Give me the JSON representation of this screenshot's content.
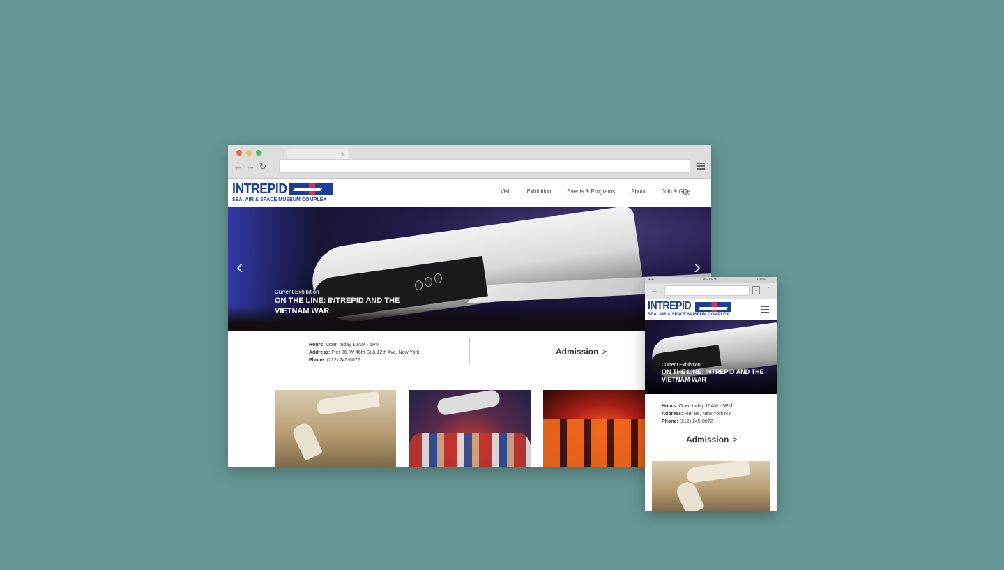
{
  "desktop": {
    "tab_close": "×",
    "nav_icons": {
      "back": "←",
      "forward": "→",
      "reload": "↻"
    },
    "logo": {
      "word": "INTREPID",
      "subtitle": "SEA, AIR & SPACE MUSEUM COMPLEX"
    },
    "nav": [
      "Visit",
      "Exhibition",
      "Events & Programs",
      "About",
      "Join & Give"
    ],
    "hero": {
      "kicker": "Current Exhibition",
      "title": "ON THE LINE: INTREPID AND THE VIETNAM WAR",
      "prev_arrow": "‹",
      "next_arrow": "›"
    },
    "info": {
      "hours_label": "Hours:",
      "hours_value": "Open today 10AM - 5PM",
      "address_label": "Address:",
      "address_value": "Pier 86, W 46th St & 12th Ave, New York",
      "phone_label": "Phone:",
      "phone_value": "(212) 245-0072"
    },
    "admission": "Admission",
    "admission_arrow": ">"
  },
  "mobile": {
    "status": {
      "left": "••••• ",
      "time": "4:21 PM",
      "right": "100%"
    },
    "back_icon": "←",
    "tabs_count": "1",
    "more_icon": "⋮",
    "logo": {
      "word": "INTREPID",
      "subtitle": "SEA, AIR & SPACE MUSEUM COMPLEX"
    },
    "hero": {
      "kicker": "Current Exhibition",
      "title": "ON THE LINE: INTREPID AND THE VIETNAM WAR"
    },
    "info": {
      "hours_label": "Hours:",
      "hours_value": "Open today 10AM - 5PM",
      "address_label": "Address:",
      "address_value": "Pier 86, New York NY",
      "phone_label": "Phone:",
      "phone_value": "(212) 245-0072"
    },
    "admission": "Admission",
    "admission_arrow": ">"
  },
  "colors": {
    "background": "#669795",
    "brand_blue": "#1a3e9a",
    "brand_red": "#d8334a",
    "traffic_red": "#f0613f",
    "traffic_yellow": "#f6b93a",
    "traffic_green": "#43c14b"
  }
}
